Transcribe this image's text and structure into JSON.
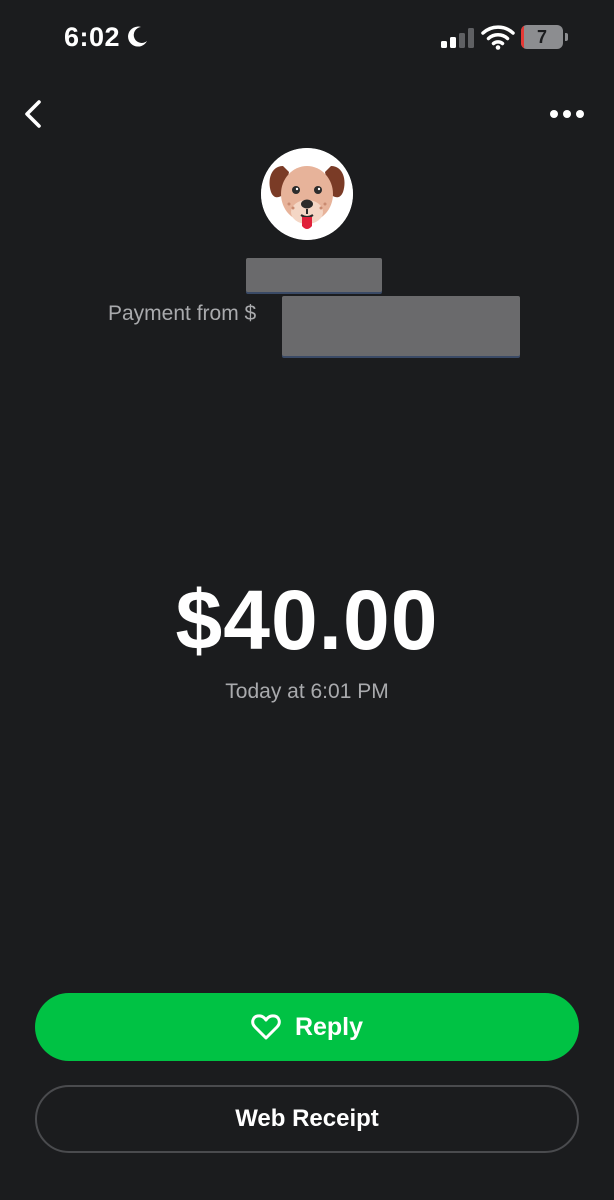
{
  "status_bar": {
    "time": "6:02",
    "battery_level": "7",
    "battery_fraction": 0.07,
    "icons": [
      "moon-icon",
      "cellular-signal-icon",
      "wifi-icon",
      "battery-icon"
    ]
  },
  "nav": {
    "back_icon": "chevron-left-icon",
    "more_icon": "more-horizontal-icon"
  },
  "payment": {
    "avatar": "dog-face-avatar",
    "from_prefix": "Payment from $",
    "amount": "$40.00",
    "timestamp": "Today at 6:01 PM"
  },
  "actions": {
    "reply_label": "Reply",
    "reply_icon": "heart-icon",
    "web_receipt_label": "Web Receipt"
  },
  "colors": {
    "background": "#1b1c1e",
    "accent_green": "#00c244",
    "secondary_text": "#a9aaad",
    "battery_low": "#e53935"
  }
}
